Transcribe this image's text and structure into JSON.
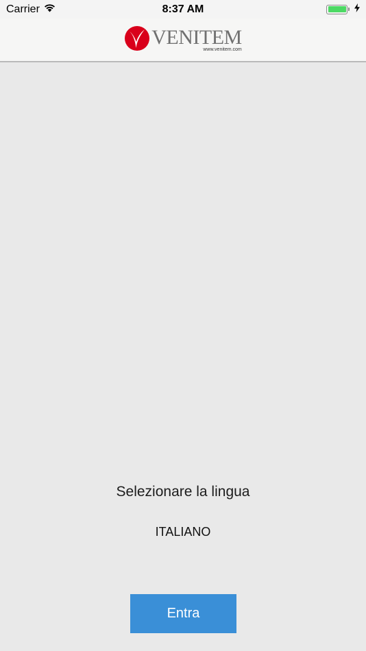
{
  "status_bar": {
    "carrier": "Carrier",
    "time": "8:37 AM",
    "battery_level": 1.0,
    "battery_color": "#4cd964"
  },
  "nav_bar": {
    "logo": {
      "word": "VENITEM",
      "url": "www.venitem.com",
      "mark_color": "#d9001b"
    }
  },
  "main": {
    "prompt": "Selezionare la lingua",
    "language": "ITALIANO",
    "enter_label": "Entra",
    "accent_color": "#3a8fd7"
  },
  "icons": {
    "wifi": "wifi-icon",
    "charging": "charging-bolt-icon",
    "battery": "battery-icon",
    "logo_mark": "venitem-logo-mark-icon"
  }
}
